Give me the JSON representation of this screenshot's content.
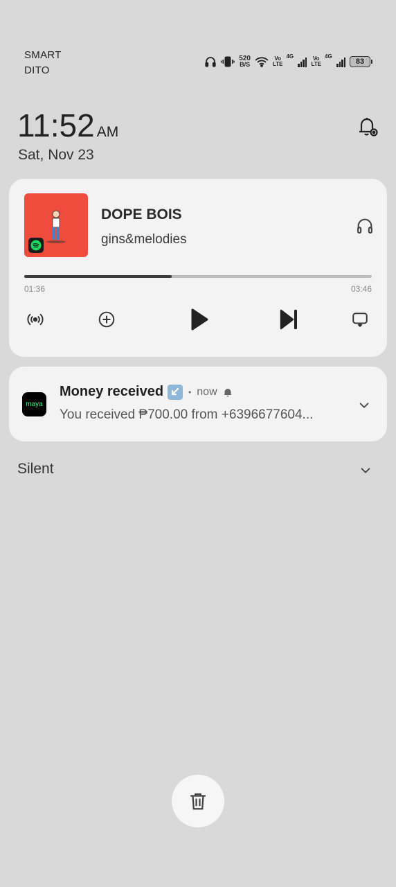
{
  "status_bar": {
    "carrier_line1": "SMART",
    "carrier_line2": "DITO",
    "net_speed_value": "520",
    "net_speed_unit": "B/S",
    "volte1_top": "Vo",
    "volte1_bottom": "LTE",
    "sig1_label": "4G",
    "volte2_top": "Vo",
    "volte2_bottom": "LTE",
    "sig2_label": "4G",
    "battery_level": "83",
    "icons": [
      "headphones-icon",
      "vibrate-icon",
      "wifi-icon",
      "battery-icon"
    ]
  },
  "clock": {
    "time": "11:52",
    "ampm": "AM",
    "date": "Sat, Nov 23"
  },
  "media": {
    "song": "DOPE BOIS",
    "artist": "gins&melodies",
    "elapsed": "01:36",
    "total": "03:46",
    "progress": 0.425,
    "art_color": "#ef4c3e",
    "controls": [
      "broadcast-icon",
      "add-icon",
      "play-icon",
      "skip-next-icon",
      "repeat-icon"
    ]
  },
  "notification": {
    "app_icon_label": "maya",
    "title": "Money received",
    "dot": "•",
    "time": "now",
    "body": "You received ₱700.00 from +6396677604..."
  },
  "sections": {
    "silent_label": "Silent"
  },
  "colors": {
    "background": "#d9d9d9",
    "card": "#f3f3f3",
    "maya_green": "#4cf08b"
  }
}
